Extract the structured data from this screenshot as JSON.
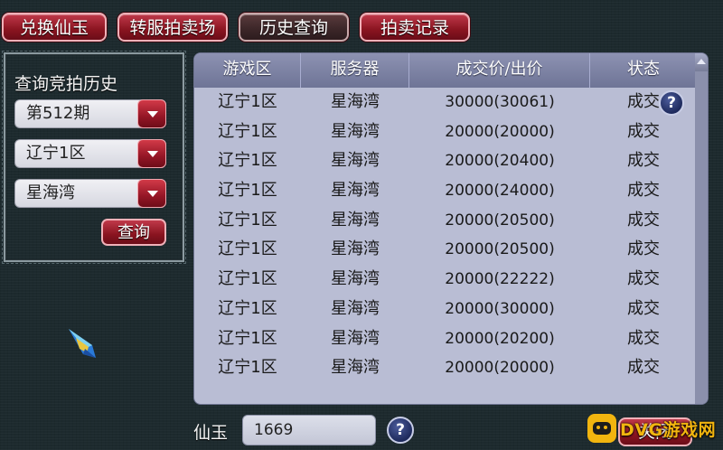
{
  "tabs": [
    {
      "label": "兑换仙玉"
    },
    {
      "label": "转服拍卖场"
    },
    {
      "label": "历史查询"
    },
    {
      "label": "拍卖记录"
    }
  ],
  "query_panel": {
    "title": "查询竞拍历史",
    "period_select": "第512期",
    "zone_select": "辽宁1区",
    "server_select": "星海湾",
    "query_button": "查询"
  },
  "table": {
    "headers": [
      "游戏区",
      "服务器",
      "成交价/出价",
      "状态"
    ],
    "rows": [
      [
        "辽宁1区",
        "星海湾",
        "30000(30061)",
        "成交"
      ],
      [
        "辽宁1区",
        "星海湾",
        "20000(20000)",
        "成交"
      ],
      [
        "辽宁1区",
        "星海湾",
        "20000(20400)",
        "成交"
      ],
      [
        "辽宁1区",
        "星海湾",
        "20000(24000)",
        "成交"
      ],
      [
        "辽宁1区",
        "星海湾",
        "20000(20500)",
        "成交"
      ],
      [
        "辽宁1区",
        "星海湾",
        "20000(20500)",
        "成交"
      ],
      [
        "辽宁1区",
        "星海湾",
        "20000(22222)",
        "成交"
      ],
      [
        "辽宁1区",
        "星海湾",
        "20000(30000)",
        "成交"
      ],
      [
        "辽宁1区",
        "星海湾",
        "20000(20200)",
        "成交"
      ],
      [
        "辽宁1区",
        "星海湾",
        "20000(20000)",
        "成交"
      ]
    ],
    "help_icon": "?"
  },
  "footer": {
    "jade_label": "仙玉",
    "jade_value": "1669",
    "help_icon": "?",
    "close_button": "关闭"
  },
  "watermark": {
    "text": "DVG游戏网"
  },
  "colors": {
    "accent_red": "#8a1420",
    "table_bg": "#b9bdd4",
    "header_bg": "#6e7496",
    "page_bg": "#1d2a2e"
  }
}
